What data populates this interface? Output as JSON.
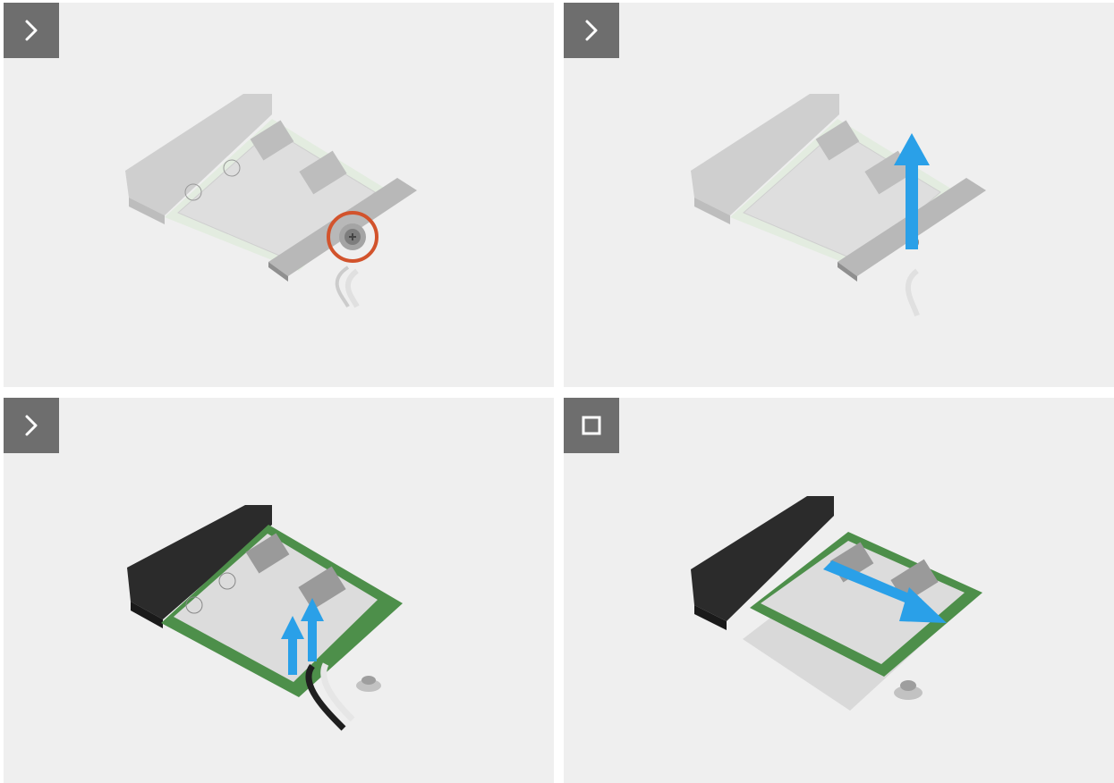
{
  "steps": [
    {
      "id": 1,
      "icon": "chevron-right-icon",
      "action": "remove-screw",
      "state": "next"
    },
    {
      "id": 2,
      "icon": "chevron-right-icon",
      "action": "lift-bracket",
      "state": "next"
    },
    {
      "id": 3,
      "icon": "chevron-right-icon",
      "action": "disconnect-antenna-cables",
      "state": "next"
    },
    {
      "id": 4,
      "icon": "stop-square-icon",
      "action": "slide-out-card",
      "state": "last"
    }
  ],
  "colors": {
    "panel_bg": "#efefef",
    "step_button": "#6e6e6e",
    "arrow_blue": "#2aa0e8",
    "screw_highlight": "#d2532c",
    "card_pcb": "#4d8f4a",
    "card_label": "#dcdcdc",
    "connector_dark": "#2b2b2b",
    "connector_ghost": "#c9c9c9"
  }
}
